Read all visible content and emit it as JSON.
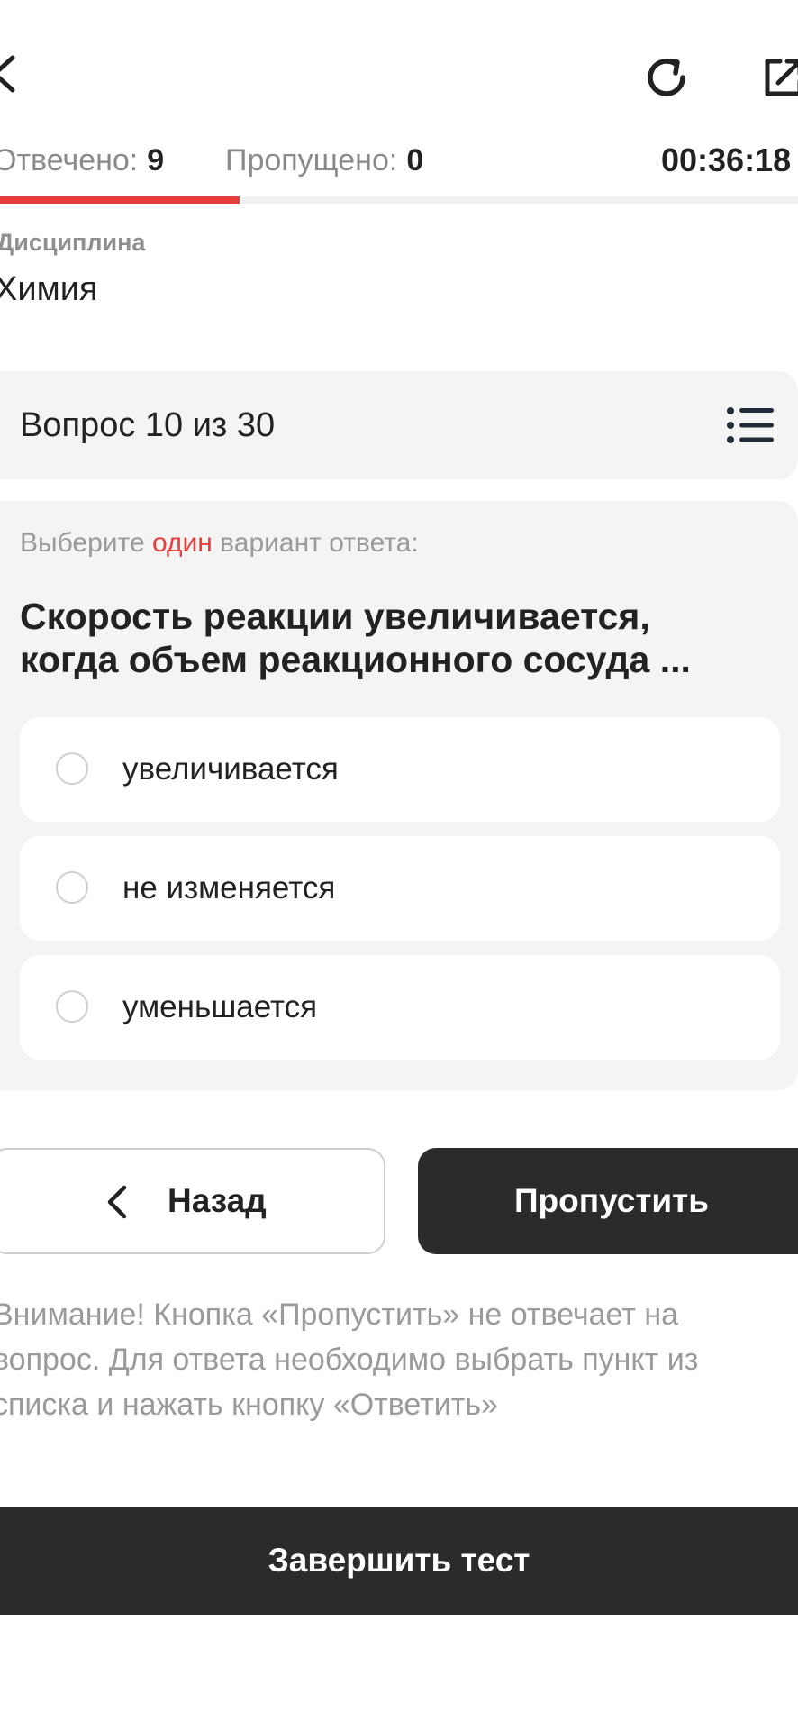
{
  "header": {
    "back_icon": "chevron-left-icon",
    "refresh_icon": "refresh-icon",
    "share_icon": "external-link-icon"
  },
  "stats": {
    "answered_label": "Отвечено:",
    "answered_value": "9",
    "skipped_label": "Пропущено:",
    "skipped_value": "0",
    "timer": "00:36:18",
    "progress_fraction": 0.3
  },
  "discipline": {
    "label": "Дисциплина",
    "value": "Химия"
  },
  "question_header": {
    "title": "Вопрос 10 из 30",
    "list_icon": "list-icon"
  },
  "question": {
    "instruction_prefix": "Выберите ",
    "instruction_accent": "один",
    "instruction_suffix": " вариант ответа:",
    "text": "Скорость реакции увеличивается, когда объем реакционного сосуда ...",
    "answers": [
      {
        "label": "увеличивается",
        "selected": false
      },
      {
        "label": "не изменяется",
        "selected": false
      },
      {
        "label": "уменьшается",
        "selected": false
      }
    ]
  },
  "buttons": {
    "back_label": "Назад",
    "skip_label": "Пропустить",
    "finish_label": "Завершить тест"
  },
  "notice": "Внимание! Кнопка «Пропустить» не отвечает на вопрос. Для ответа необходимо выбрать пункт из списка и нажать кнопку «Ответить»",
  "colors": {
    "accent": "#e93d3d",
    "dark_button": "#2b2b2b",
    "card_background": "#f4f4f4",
    "muted_text": "#9a9a9a"
  }
}
